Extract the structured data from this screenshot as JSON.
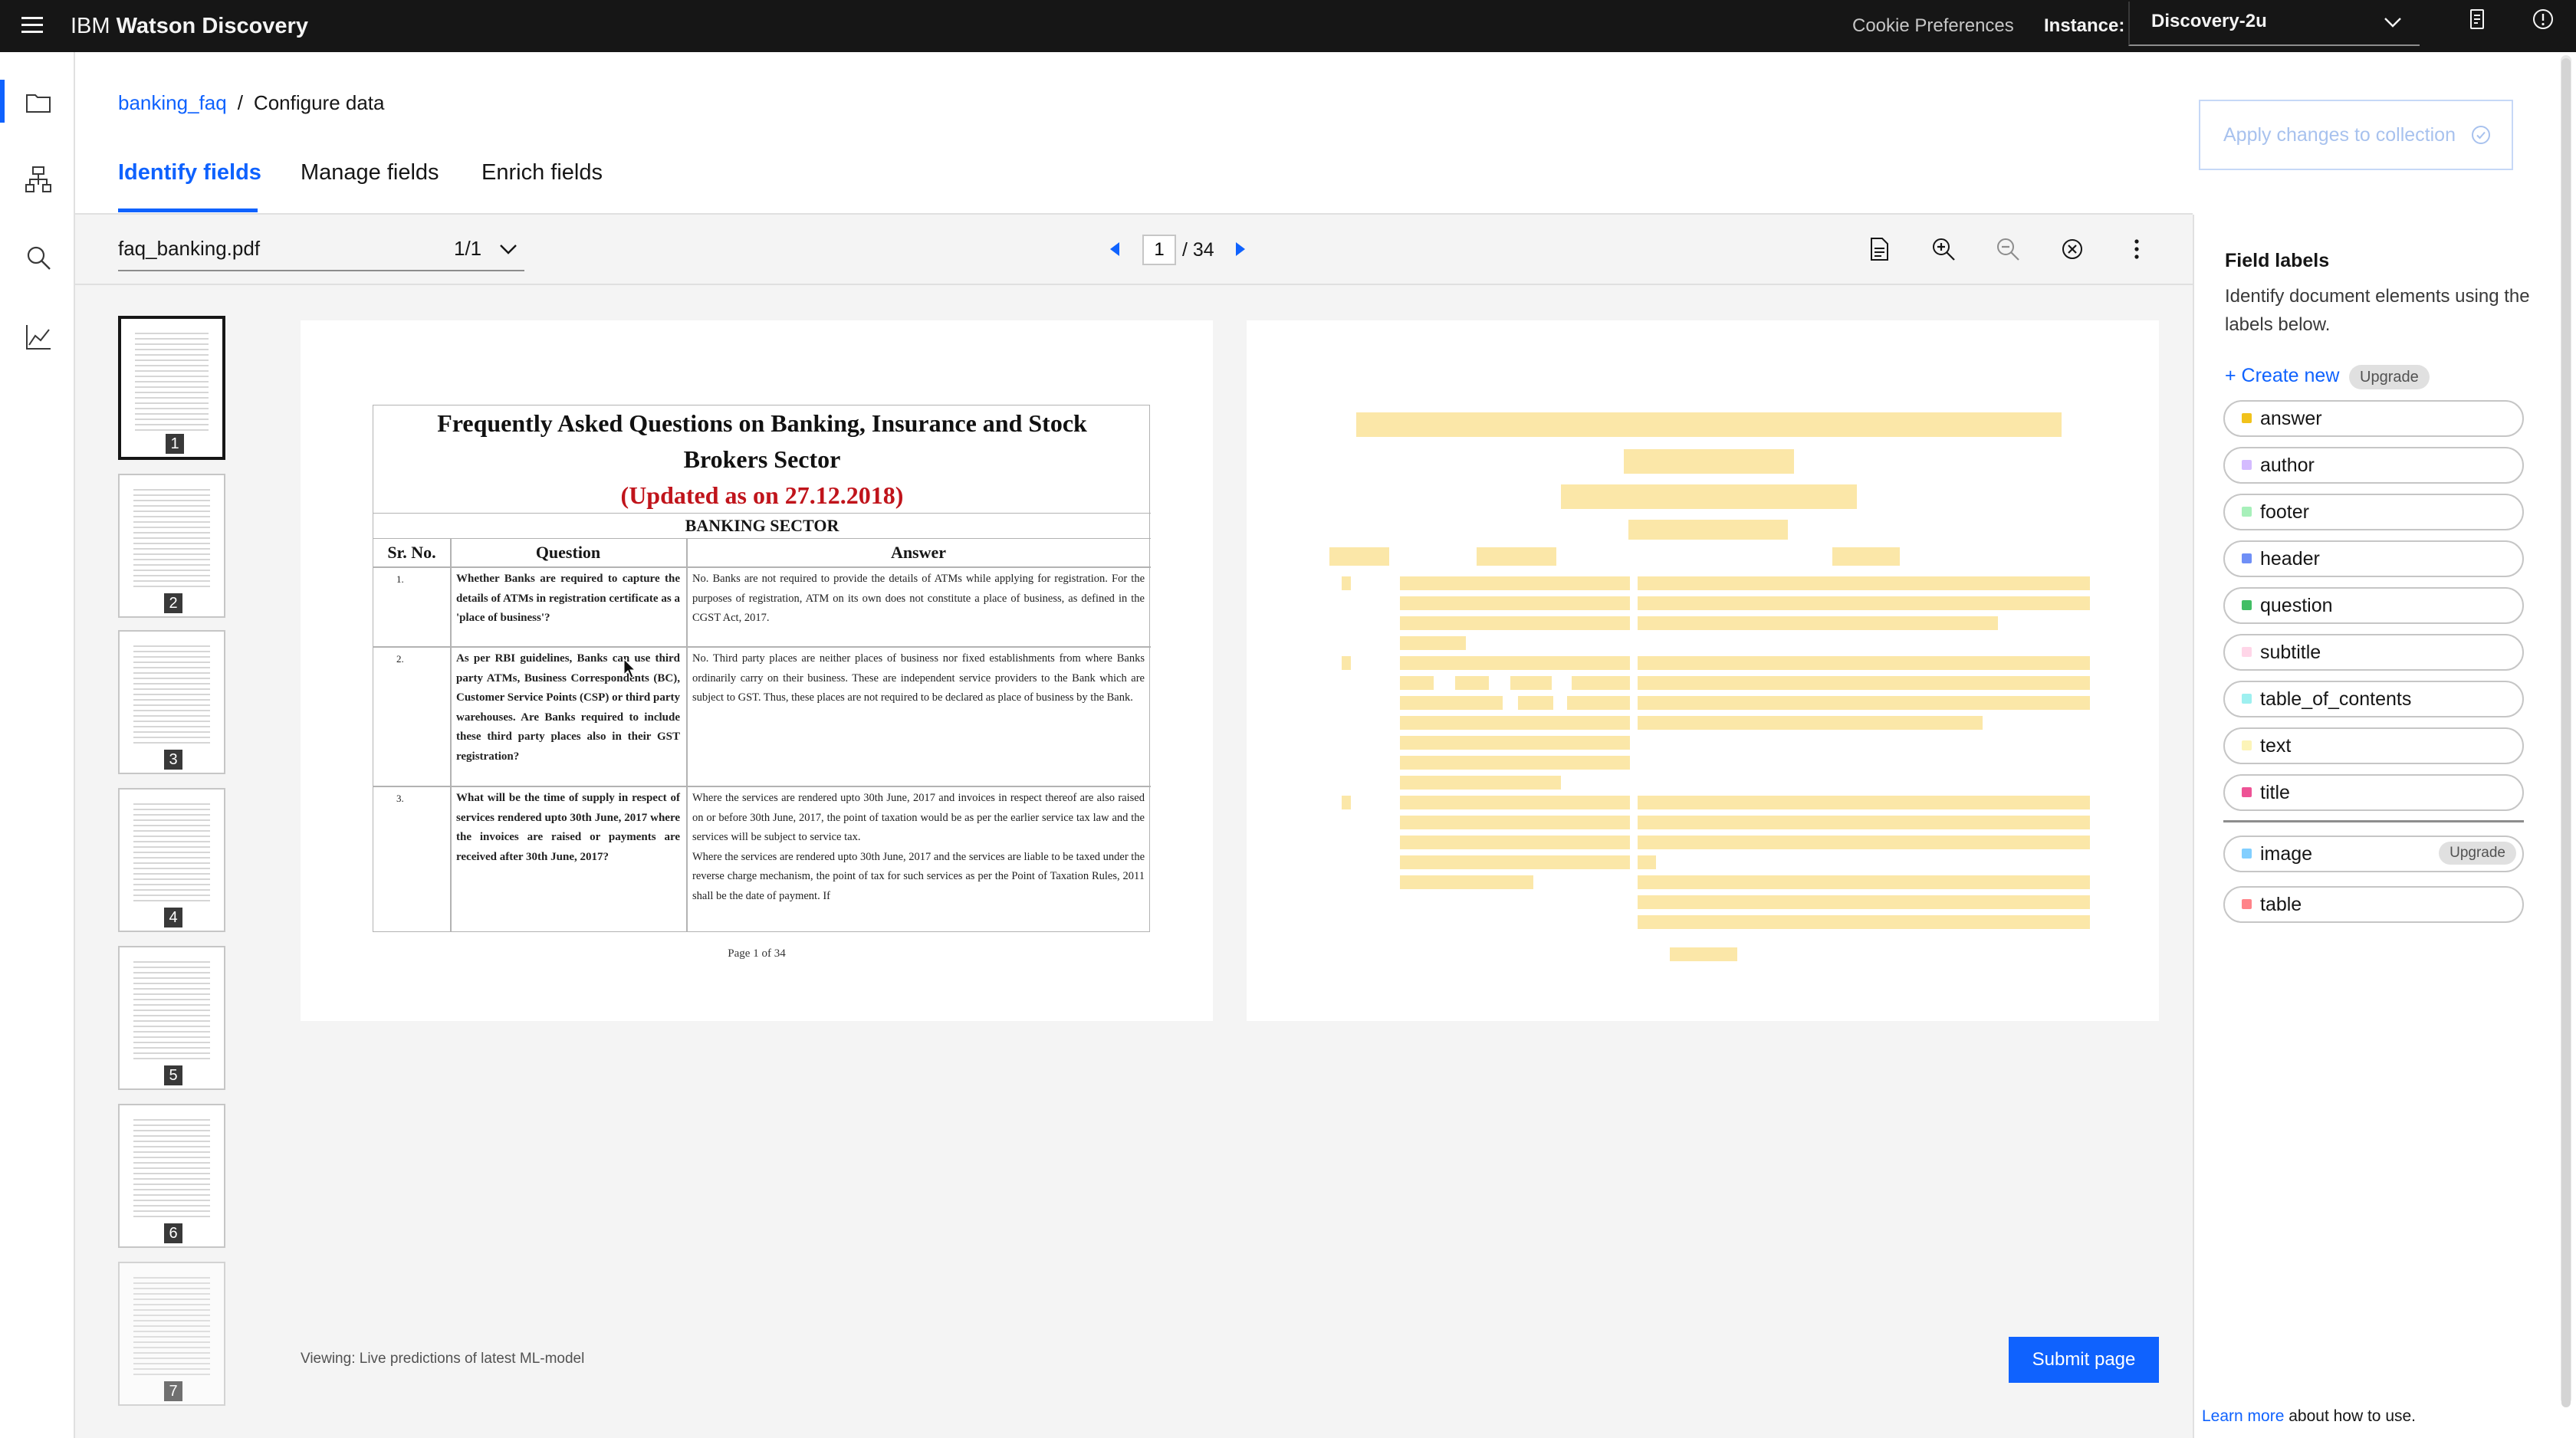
{
  "header": {
    "brand_prefix": "IBM",
    "brand_name": "Watson Discovery",
    "cookie_preferences": "Cookie Preferences",
    "instance_label": "Instance:",
    "instance_value": "Discovery-2u"
  },
  "rail": {
    "items": [
      {
        "icon": "folder-icon"
      },
      {
        "icon": "data-structure-icon"
      },
      {
        "icon": "search-icon"
      },
      {
        "icon": "analytics-chart-icon"
      }
    ]
  },
  "breadcrumb": {
    "collection": "banking_faq",
    "separator": "/",
    "current": "Configure data"
  },
  "tabs": [
    {
      "label": "Identify fields",
      "selected": true
    },
    {
      "label": "Manage fields",
      "selected": false
    },
    {
      "label": "Enrich fields",
      "selected": false
    }
  ],
  "apply_button": {
    "label": "Apply changes to collection",
    "enabled": false
  },
  "toolbar": {
    "file_name": "faq_banking.pdf",
    "file_count": "1/1",
    "current_page": "1",
    "total_pages": "/ 34"
  },
  "thumbnails": [
    {
      "number": "1",
      "active": true
    },
    {
      "number": "2",
      "active": false
    },
    {
      "number": "3",
      "active": false
    },
    {
      "number": "4",
      "active": false
    },
    {
      "number": "5",
      "active": false
    },
    {
      "number": "6",
      "active": false
    },
    {
      "number": "7",
      "active": false
    }
  ],
  "pdf": {
    "title_line1": "Frequently Asked Questions on Banking, Insurance and Stock",
    "title_line2": "Brokers Sector",
    "updated": "(Updated as on 27.12.2018)",
    "sector": "BANKING SECTOR",
    "col_srno": "Sr. No.",
    "col_question": "Question",
    "col_answer": "Answer",
    "rows": [
      {
        "num": "1.",
        "question": "Whether Banks are required to capture the details of ATMs in registration certificate as a 'place of business'?",
        "answer": "No. Banks are not required to provide the details of ATMs while applying for registration. For the purposes of registration, ATM on its own does not constitute a place of business, as defined in the CGST Act, 2017."
      },
      {
        "num": "2.",
        "question": "As per RBI guidelines, Banks can use third party ATMs, Business Correspondents (BC), Customer Service Points (CSP) or third party warehouses. Are Banks required to include these third party places also in their GST registration?",
        "answer": "No. Third party places are neither places of business nor fixed establishments from where Banks ordinarily carry on their business. These are independent service providers to the Bank which are subject to GST. Thus, these places are not required to be declared as place of business by the Bank."
      },
      {
        "num": "3.",
        "question": "What will be the time of supply in respect of services rendered upto 30th June, 2017 where the invoices are raised or payments are received after 30th June, 2017?",
        "answer": "Where the services are rendered upto 30th June, 2017 and invoices in respect thereof are also raised on or before 30th June, 2017, the point of taxation would be as per the earlier service tax law and the services will be subject to service tax.",
        "answer_2": "Where the services are rendered upto 30th June, 2017 and the services are liable to be taxed under the reverse charge mechanism, the point of tax for such services as per the Point of Taxation Rules, 2011 shall be the date of payment. If"
      }
    ],
    "page_label": "Page 1 of 34"
  },
  "field_labels": {
    "title": "Field labels",
    "description": "Identify document elements using the labels below.",
    "create_new": "+ Create new",
    "upgrade": "Upgrade",
    "labels": [
      {
        "name": "answer",
        "color": "#f1c21b"
      },
      {
        "name": "author",
        "color": "#d4bbff"
      },
      {
        "name": "footer",
        "color": "#a7f0ba"
      },
      {
        "name": "header",
        "color": "#6f8ff6"
      },
      {
        "name": "question",
        "color": "#42be65"
      },
      {
        "name": "subtitle",
        "color": "#ffd6e8"
      },
      {
        "name": "table_of_contents",
        "color": "#9ef0f0"
      },
      {
        "name": "text",
        "color": "#fcf4b8"
      },
      {
        "name": "title",
        "color": "#ee5396"
      }
    ],
    "extra_labels": [
      {
        "name": "image",
        "color": "#82cfff",
        "upgrade": "Upgrade"
      },
      {
        "name": "table",
        "color": "#ff8389"
      }
    ]
  },
  "footer": {
    "viewing_note": "Viewing: Live predictions of latest ML-model",
    "submit_label": "Submit page",
    "learn_more_link": "Learn more",
    "learn_more_text": " about how to use."
  }
}
